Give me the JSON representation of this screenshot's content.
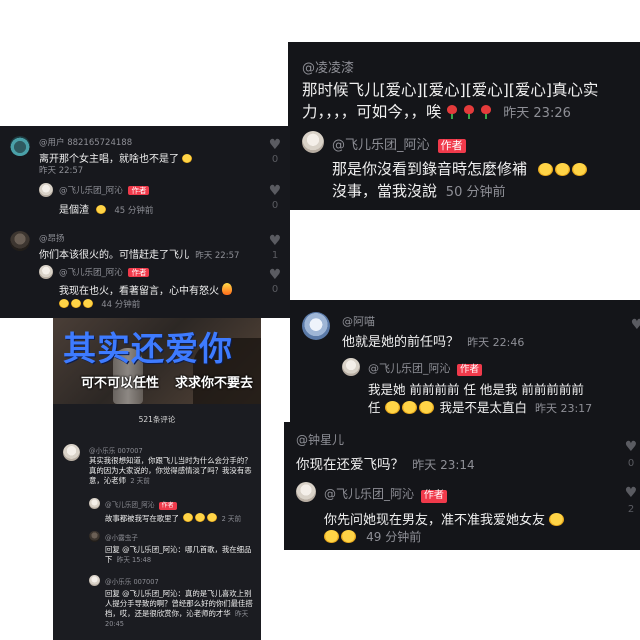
{
  "panel_a": {
    "top": {
      "username": "@凌凌漆",
      "text": "那时候飞儿[爱心][爱心][爱心][爱心]真心实力，，，，可如今，，唉",
      "time": "昨天 23:26"
    },
    "reply": {
      "username": "@飞儿乐团_阿沁",
      "badge": "作者",
      "text": "那是你沒看到錄音時怎麼修補",
      "text2": "沒事，當我沒說",
      "time": "50 分钟前"
    }
  },
  "panel_b": {
    "c1": {
      "username": "@用户 882165724188",
      "text": "离开那个女主唱，就啥也不是了",
      "time": "昨天 22:57",
      "likes": "0"
    },
    "r1": {
      "username": "@飞儿乐团_阿沁",
      "badge": "作者",
      "text": "是個渣",
      "time": "45 分钟前",
      "likes": "0"
    },
    "c2": {
      "username": "@昂扬",
      "text": "你们本该很火的。可惜赶走了飞儿",
      "time": "昨天 22:57",
      "likes": "1"
    },
    "r2": {
      "username": "@飞儿乐团_阿沁",
      "badge": "作者",
      "text": "我现在也火，看著留言，心中有怒火",
      "time": "44 分钟前",
      "likes": "0"
    }
  },
  "panel_c": {
    "video": {
      "title": "其实还爱你",
      "subtitle_left": "可不可以任性",
      "subtitle_right": "求求你不要去"
    },
    "count": "521条评论",
    "c1": {
      "username": "@小乐乐 007007",
      "text": "其实我很想知道，你跟飞儿当时为什么会分手的？真的因为大家说的，你觉得感情淡了吗？我没有恶意，沁老师",
      "time": "2 天前"
    },
    "r1": {
      "username": "@飞儿乐团_阿沁",
      "badge": "作者",
      "text": "故事都被我写在歌里了",
      "time": "2 天前"
    },
    "r2": {
      "username": "@小露虫子",
      "text": "回复 @飞儿乐团_阿沁：哪几首歌，我在细品下",
      "time": "昨天 15:48"
    },
    "r3": {
      "username": "@小乐乐 007007",
      "text": "回复 @飞儿乐团_阿沁：真的是飞儿喜欢上别人提分手导致的啊？曾经那么好的你们最佳搭档，哎，还是很欣赏你，沁老师的才华",
      "time": "昨天 20:45"
    }
  },
  "panel_d": {
    "top": {
      "username": "@阿喵",
      "text": "他就是她的前任吗？",
      "time": "昨天 22:46"
    },
    "reply": {
      "username": "@飞儿乐团_阿沁",
      "badge": "作者",
      "text": "我是她 前前前前 任 他是我 前前前前前",
      "text2": "任",
      "text3": "我是不是太直白",
      "time": "昨天 23:17"
    }
  },
  "panel_e": {
    "top": {
      "username": "@钟星儿",
      "text": "你现在还爱飞吗？",
      "time": "昨天 23:14",
      "likes": "0"
    },
    "reply": {
      "username": "@飞儿乐团_阿沁",
      "badge": "作者",
      "text": "你先问她现在男友，准不准我爱她女友",
      "time": "49 分钟前",
      "likes": "2"
    }
  }
}
